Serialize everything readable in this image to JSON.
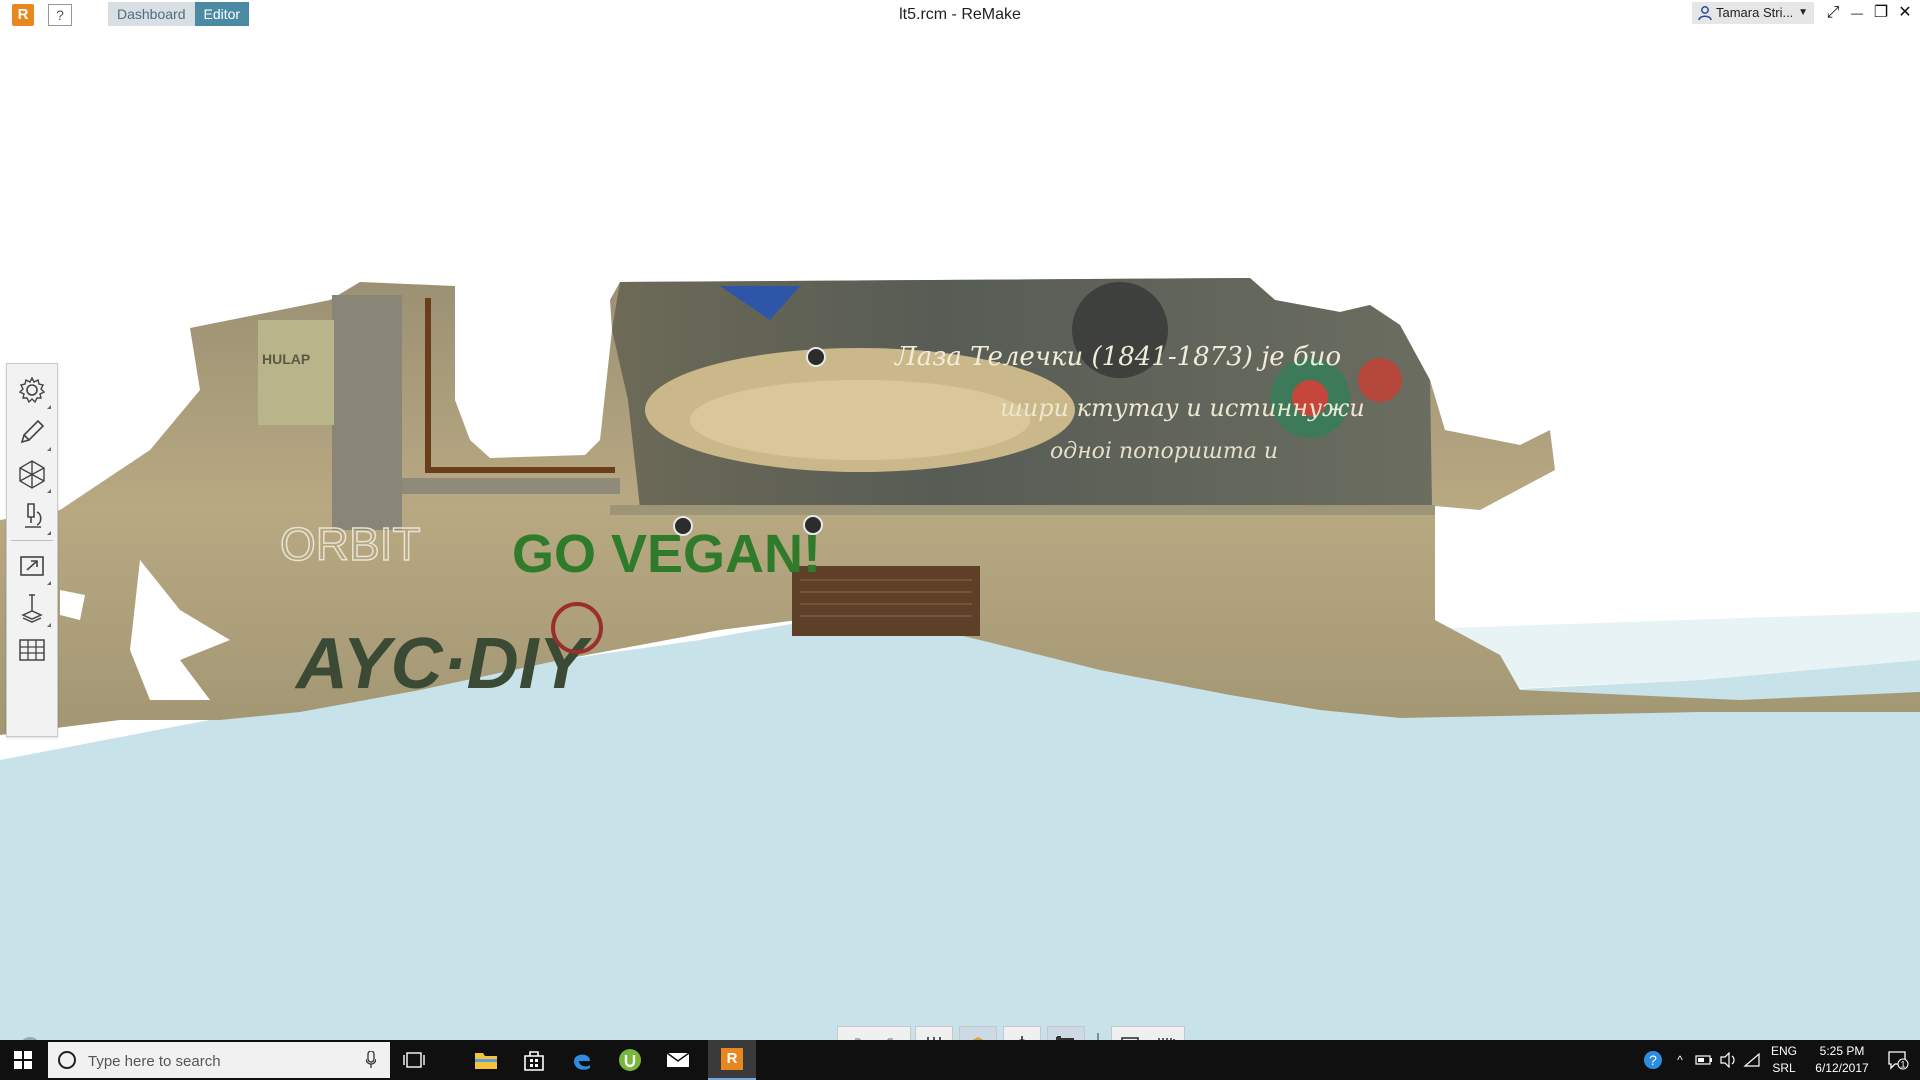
{
  "app": {
    "logo_letter": "R",
    "help_label": "?",
    "tabs": [
      {
        "label": "Dashboard",
        "active": false
      },
      {
        "label": "Editor",
        "active": true
      }
    ],
    "window_title": "lt5.rcm - ReMake",
    "user_name": "Tamara Stri...",
    "window_buttons": {
      "fullscreen": "⤢",
      "minimize": "—",
      "restore": "❐",
      "close": "✕"
    }
  },
  "scene": {
    "graffiti_main": "GO VEGAN!",
    "graffiti_left": "AYC·DIY",
    "graffiti_sketch": "ORBIT",
    "mural_text": "Лаза Телечки (1841-1873) је био",
    "mural_text_2": "шири ктутау и истиннужи",
    "mural_text_3": "одноі попоришта и",
    "poster_text": "HULAP",
    "colors": {
      "ground": "#c8e2e9",
      "wall": "#b5a57a"
    }
  },
  "tool_panel": {
    "tools": [
      {
        "name": "settings",
        "icon": "gear-icon"
      },
      {
        "name": "edit",
        "icon": "pencil-icon"
      },
      {
        "name": "mesh",
        "icon": "mesh-icon"
      },
      {
        "name": "analyze",
        "icon": "microscope-icon"
      },
      {
        "name": "export",
        "icon": "export-icon"
      },
      {
        "name": "measure",
        "icon": "measure-icon"
      },
      {
        "name": "grid",
        "icon": "grid-icon"
      }
    ]
  },
  "taskbar": {
    "search_placeholder": "Type here to search",
    "lang_top": "ENG",
    "lang_bottom": "SRL",
    "time": "5:25 PM",
    "date": "6/12/2017",
    "notification_count": "1",
    "apps": [
      "task-view-icon",
      "file-explorer-icon",
      "store-icon",
      "edge-icon",
      "utorrent-icon",
      "mail-icon",
      "remake-icon"
    ]
  }
}
